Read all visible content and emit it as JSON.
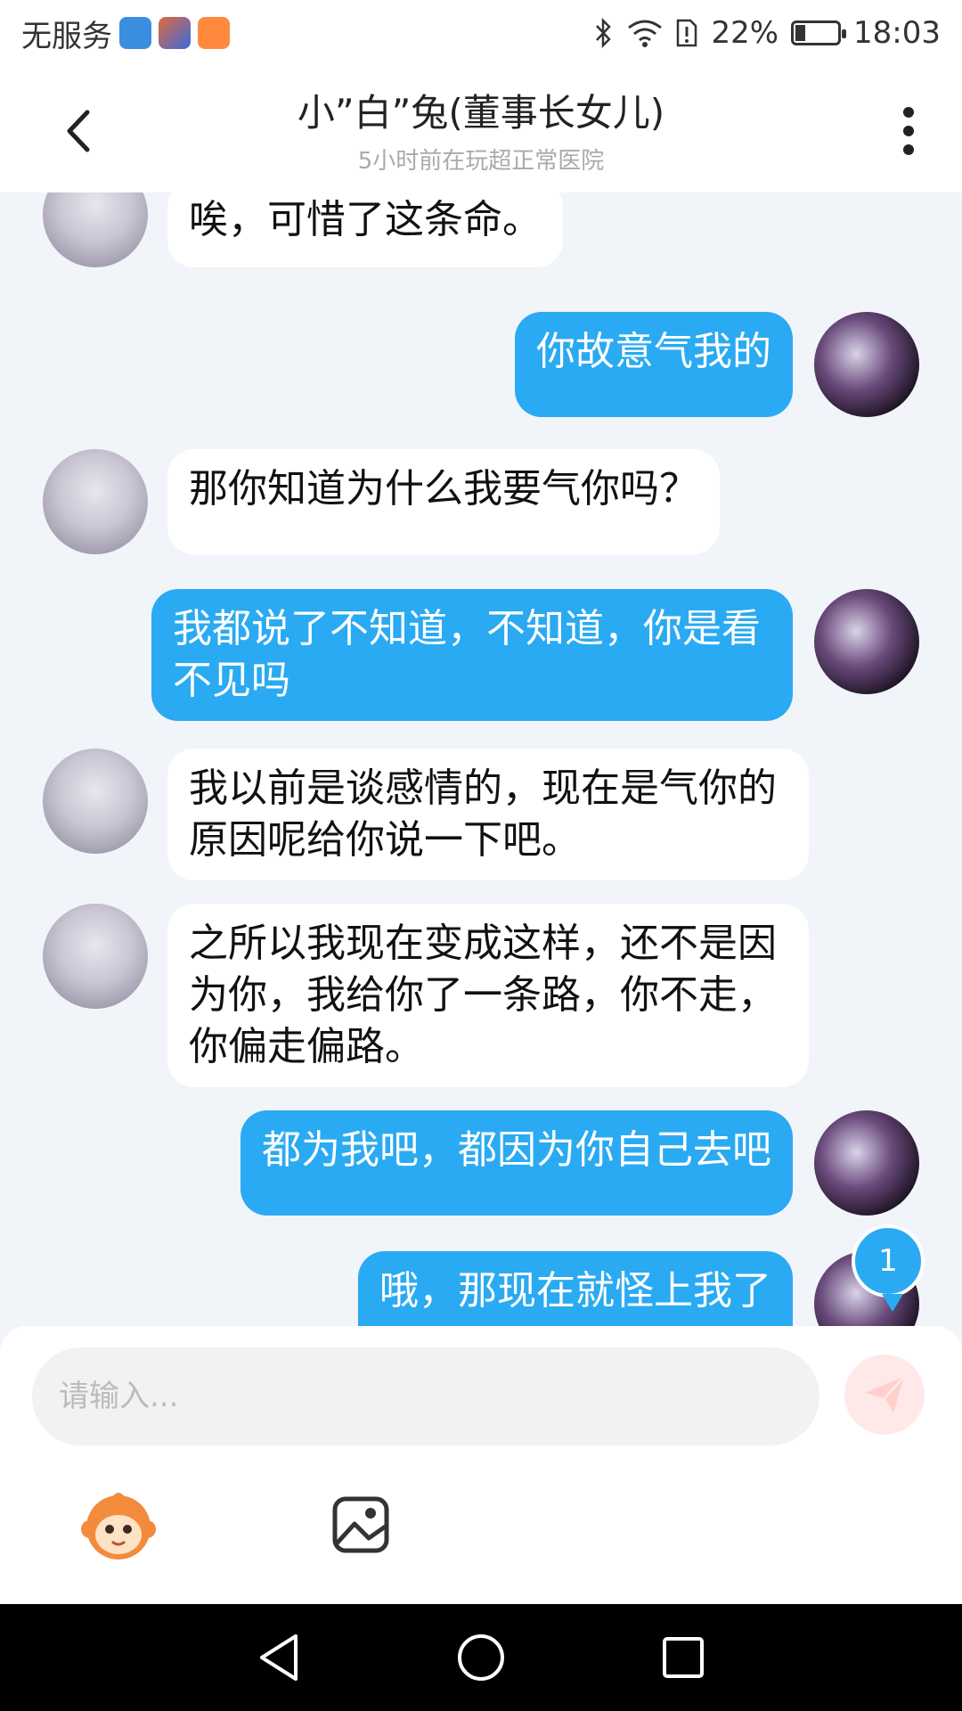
{
  "status_bar": {
    "carrier": "无服务",
    "battery": "22%",
    "time": "18:03"
  },
  "header": {
    "title": "小”白”兔(董事长女儿)",
    "subtitle": "5小时前在玩超正常医院"
  },
  "messages": [
    {
      "side": "left",
      "text": "唉，可惜了这条命。"
    },
    {
      "side": "right",
      "text": "你故意气我的"
    },
    {
      "side": "left",
      "text": "那你知道为什么我要气你吗？"
    },
    {
      "side": "right",
      "text": "我都说了不知道，不知道，你是看不见吗"
    },
    {
      "side": "left",
      "text": "我以前是谈感情的，现在是气你的原因呢给你说一下吧。"
    },
    {
      "side": "left",
      "text": "之所以我现在变成这样，还不是因为你，我给你了一条路，你不走，你偏走偏路。"
    },
    {
      "side": "right",
      "text": "都为我吧，都因为你自己去吧"
    },
    {
      "side": "right",
      "text": "哦，那现在就怪上我了"
    }
  ],
  "unread_count": "1",
  "input": {
    "placeholder": "请输入..."
  },
  "colors": {
    "self_bubble": "#2aaaf2",
    "other_bubble": "#ffffff",
    "background": "#f1f4f9"
  },
  "icons": {
    "back": "chevron-left-icon",
    "more": "more-vertical-icon",
    "send": "paper-plane-icon",
    "emoji": "monkey-face-icon",
    "image": "image-icon",
    "nav_back": "triangle-back-icon",
    "nav_home": "circle-home-icon",
    "nav_recent": "square-recent-icon"
  }
}
